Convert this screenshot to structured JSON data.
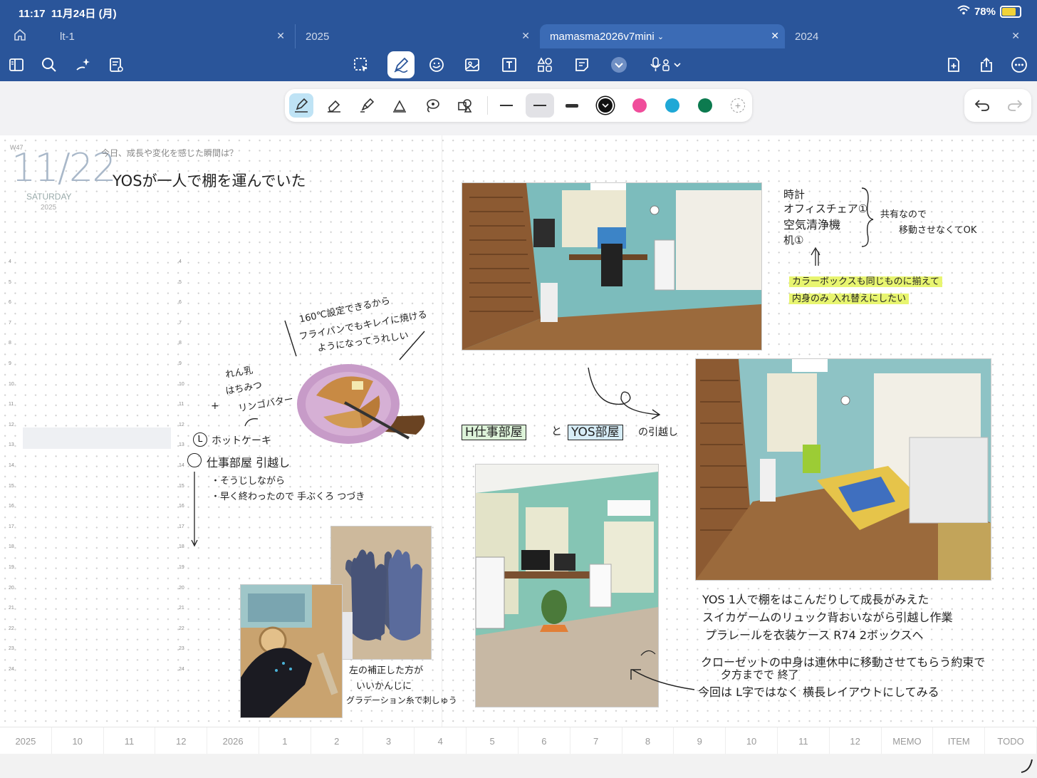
{
  "status": {
    "time": "11:17",
    "date": "11月24日 (月)",
    "battery": "78%"
  },
  "tabs": [
    {
      "label": "lt-1"
    },
    {
      "label": "2025"
    },
    {
      "label": "mamasma2026v7mini"
    },
    {
      "label": "2024"
    }
  ],
  "day": {
    "week": "W47",
    "date": "11/22",
    "weekday": "SATURDAY",
    "year": "2025",
    "prompt": "今日、成長や変化を感じた瞬間は？",
    "answer": "YOSが一人で棚を運んでいた"
  },
  "time_rows": [
    "4",
    "5",
    "6",
    "7",
    "8",
    "9",
    "10",
    "11",
    "12",
    "13",
    "14",
    "15",
    "16",
    "17",
    "18",
    "19",
    "20",
    "21",
    "22",
    "23",
    "24"
  ],
  "left_notes": {
    "pancake_caption_1": "160℃設定できるから",
    "pancake_caption_2": "フライパンでもキレイに焼ける",
    "pancake_caption_3": "ようになってうれしい",
    "toppings_1": "れん乳",
    "toppings_2": "はちみつ",
    "toppings_3": "リンゴバター",
    "plus": "+",
    "task_1": "ホットケーキ",
    "task_1_mark": "L",
    "task_2": "仕事部屋 引越し",
    "bullet_1": "・そうじしながら",
    "bullet_2": "・早く終わったので 手ぶくろ つづき",
    "glove_caption_1": "左の補正した方が",
    "glove_caption_2": "いいかんじに",
    "glove_caption_3": "グラデーション糸で刺しゅう"
  },
  "right_notes": {
    "list_1": "時計",
    "list_2": "オフィスチェア①",
    "list_3": "空気清浄機",
    "list_4": "机①",
    "shared_1": "共有なので",
    "shared_2": "移動させなくてOK",
    "highlight_1": "カラーボックスも同じものに揃えて",
    "highlight_2": "内身のみ 入れ替えにしたい",
    "box_h": "H仕事部屋",
    "to": "と",
    "box_yos": "YOS部屋",
    "move": "の引越し",
    "note_1": "YOS 1人で棚をはこんだりして成長がみえた",
    "note_2": "スイカゲームのリュック背おいながら引越し作業",
    "note_3": "プラレールを衣装ケース R74 2ボックスへ",
    "note_4": "クローゼットの中身は連休中に移動させてもらう約束で",
    "note_5": "夕方までで 終了",
    "note_6": "今回は L字ではなく 横長レイアウトにしてみる"
  },
  "months": [
    "2025",
    "10",
    "11",
    "12",
    "2026",
    "1",
    "2",
    "3",
    "4",
    "5",
    "6",
    "7",
    "8",
    "9",
    "10",
    "11",
    "12",
    "MEMO",
    "ITEM",
    "TODO"
  ],
  "colors": {
    "pink": "#f04d9b",
    "cyan": "#1fa8d6",
    "green": "#0c7a4f",
    "black": "#111111",
    "highlight": "#e8f570"
  },
  "icons": [
    "sidebar-icon",
    "search-icon",
    "sparkle-icon",
    "document-icon",
    "lasso-icon",
    "pen-icon",
    "sticker-icon",
    "image-icon",
    "textbox-icon",
    "shapes-icon",
    "note-icon",
    "chevron-down-icon",
    "mic-icon",
    "add-page-icon",
    "share-icon",
    "more-icon"
  ]
}
